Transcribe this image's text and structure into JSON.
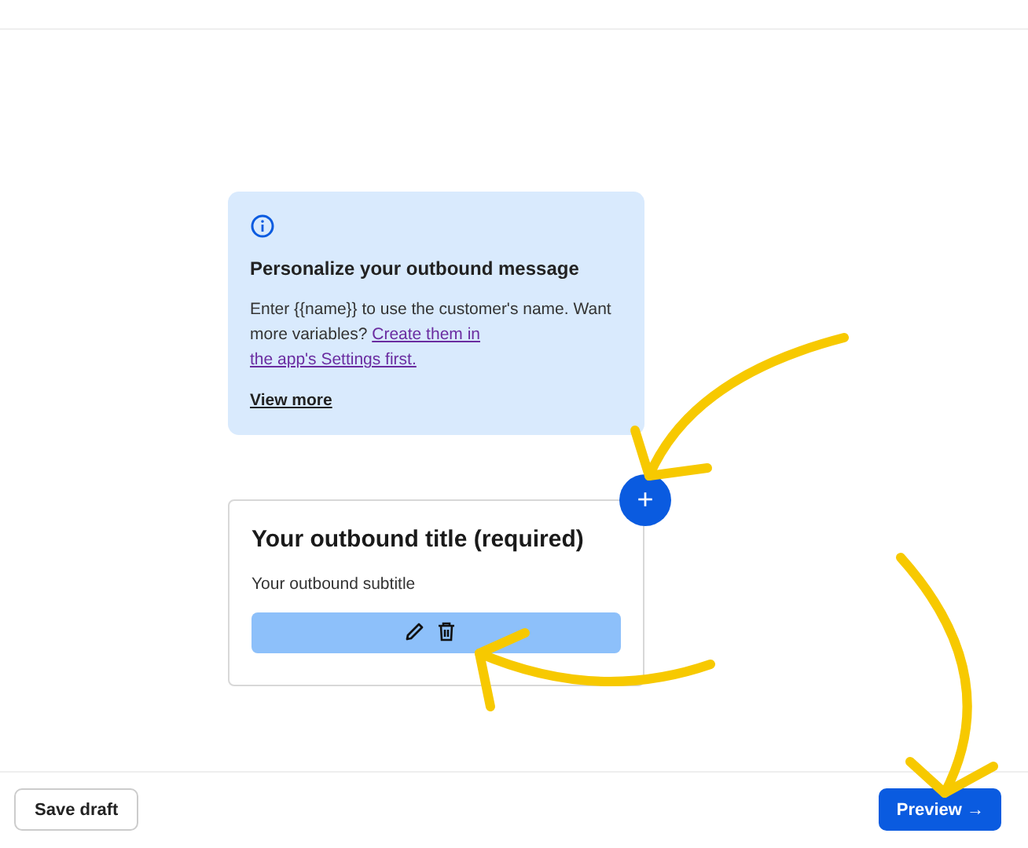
{
  "info_card": {
    "title": "Personalize your outbound message",
    "text": "Enter {{name}} to use the customer's name. Want more variables? ",
    "link_lines": [
      "Create them in",
      "the app's Settings first."
    ],
    "view_more": "View more"
  },
  "add_button": {
    "label": "+"
  },
  "outbound_card": {
    "title": "Your outbound title (required)",
    "subtitle": "Your outbound subtitle"
  },
  "footer": {
    "save_draft": "Save draft",
    "preview": "Preview →"
  }
}
